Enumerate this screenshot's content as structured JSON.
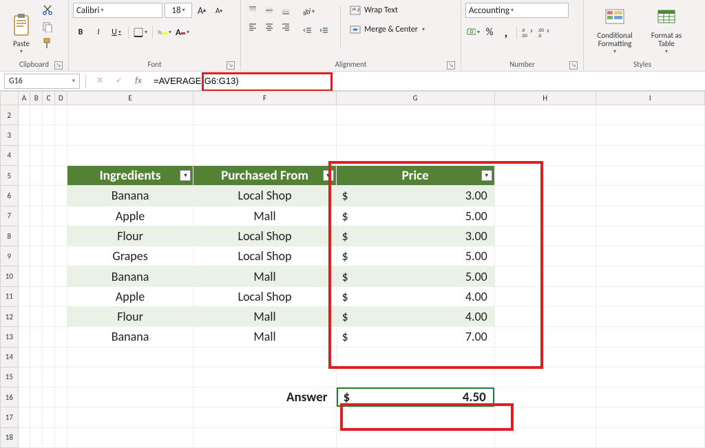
{
  "ribbon": {
    "clipboard": {
      "label": "Clipboard",
      "paste": "Paste"
    },
    "font": {
      "label": "Font",
      "name": "Calibri",
      "size": "18",
      "bold": "B",
      "italic": "I",
      "underline": "U"
    },
    "alignment": {
      "label": "Alignment",
      "wrap": "Wrap Text",
      "merge": "Merge & Center"
    },
    "number": {
      "label": "Number",
      "format": "Accounting",
      "pct": "%",
      "comma": ","
    },
    "styles": {
      "label": "Styles",
      "cond": "Conditional Formatting",
      "table": "Format as Table"
    }
  },
  "formula_bar": {
    "cell_ref": "G16",
    "fx": "fx",
    "formula": "=AVERAGE(G6:G13)"
  },
  "columns": {
    "A": "A",
    "B": "B",
    "C": "C",
    "D": "D",
    "E": "E",
    "F": "F",
    "G": "G",
    "H": "H",
    "I": "I"
  },
  "rows": [
    "2",
    "3",
    "4",
    "5",
    "6",
    "7",
    "8",
    "9",
    "10",
    "11",
    "12",
    "13",
    "14",
    "15",
    "16",
    "17",
    "18"
  ],
  "table": {
    "headers": {
      "ingredients": "Ingredients",
      "purchased_from": "Purchased From",
      "price": "Price"
    },
    "rows": [
      {
        "ing": "Banana",
        "from": "Local Shop",
        "cur": "$",
        "val": "3.00"
      },
      {
        "ing": "Apple",
        "from": "Mall",
        "cur": "$",
        "val": "5.00"
      },
      {
        "ing": "Flour",
        "from": "Local Shop",
        "cur": "$",
        "val": "3.00"
      },
      {
        "ing": "Grapes",
        "from": "Local Shop",
        "cur": "$",
        "val": "5.00"
      },
      {
        "ing": "Banana",
        "from": "Mall",
        "cur": "$",
        "val": "5.00"
      },
      {
        "ing": "Apple",
        "from": "Local Shop",
        "cur": "$",
        "val": "4.00"
      },
      {
        "ing": "Flour",
        "from": "Mall",
        "cur": "$",
        "val": "4.00"
      },
      {
        "ing": "Banana",
        "from": "Mall",
        "cur": "$",
        "val": "7.00"
      }
    ]
  },
  "answer": {
    "label": "Answer",
    "cur": "$",
    "val": "4.50"
  },
  "chart_data": {
    "type": "table",
    "title": "Ingredient Prices",
    "columns": [
      "Ingredients",
      "Purchased From",
      "Price"
    ],
    "rows": [
      [
        "Banana",
        "Local Shop",
        3.0
      ],
      [
        "Apple",
        "Mall",
        5.0
      ],
      [
        "Flour",
        "Local Shop",
        3.0
      ],
      [
        "Grapes",
        "Local Shop",
        5.0
      ],
      [
        "Banana",
        "Mall",
        5.0
      ],
      [
        "Apple",
        "Local Shop",
        4.0
      ],
      [
        "Flour",
        "Mall",
        4.0
      ],
      [
        "Banana",
        "Mall",
        7.0
      ]
    ],
    "summary": {
      "label": "Answer (AVERAGE)",
      "value": 4.5
    }
  }
}
